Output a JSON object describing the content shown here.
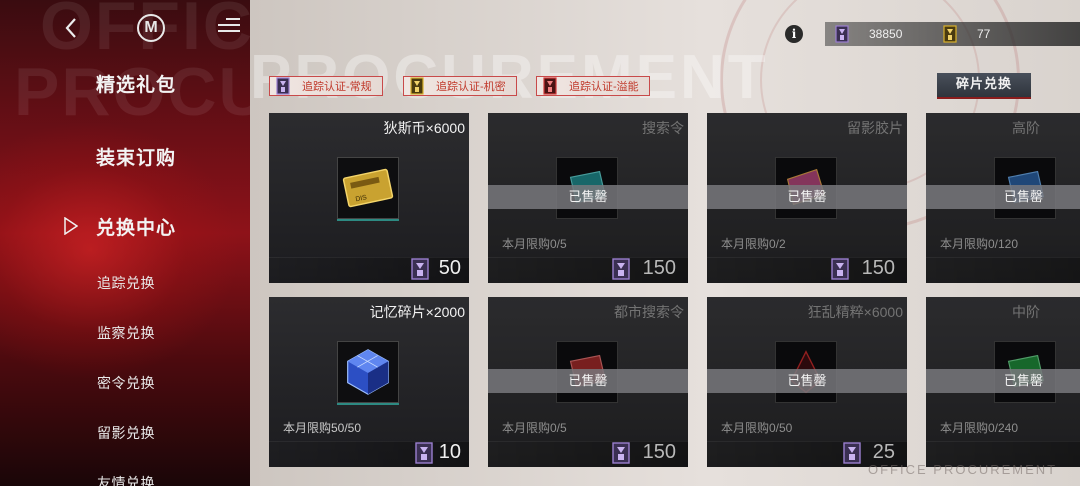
{
  "sidebar": {
    "nav_main": [
      {
        "label": "精选礼包"
      },
      {
        "label": "装束订购"
      },
      {
        "label": "兑换中心"
      }
    ],
    "nav_sub": [
      {
        "label": "追踪兑换"
      },
      {
        "label": "监察兑换"
      },
      {
        "label": "密令兑换"
      },
      {
        "label": "留影兑换"
      },
      {
        "label": "友情兑换"
      }
    ],
    "logo_letter": "M",
    "background_words": [
      "OFFICE",
      "PROCUREMENT"
    ]
  },
  "header": {
    "currencies": [
      {
        "icon": "tracking-cert-standard-icon",
        "amount": "38850",
        "color": "#9b7fd0"
      },
      {
        "icon": "tracking-cert-classified-icon",
        "amount": "77",
        "color": "#d9b12c"
      }
    ]
  },
  "filters": [
    {
      "label": "追踪认证-常规",
      "icon_color": "#9b7fd0"
    },
    {
      "label": "追踪认证-机密",
      "icon_color": "#d9b12c"
    },
    {
      "label": "追踪认证-溢能",
      "icon_color": "#d23a3a"
    }
  ],
  "fragment_exchange_label": "碎片兑换",
  "cards": [
    {
      "title": "狄斯币×6000",
      "limit": "",
      "price": "50",
      "sold_out": false,
      "thumb": "coin-pack"
    },
    {
      "title": "搜索令",
      "limit": "本月限购0/5",
      "price": "150",
      "sold_out": true,
      "thumb": "search-order"
    },
    {
      "title": "留影胶片",
      "limit": "本月限购0/2",
      "price": "150",
      "sold_out": true,
      "thumb": "film"
    },
    {
      "title": "高阶",
      "limit": "本月限购0/120",
      "price": "",
      "sold_out": true,
      "thumb": "advanced"
    },
    {
      "title": "记忆碎片×2000",
      "limit": "本月限购50/50",
      "price": "10",
      "sold_out": false,
      "thumb": "memory-cube"
    },
    {
      "title": "都市搜索令",
      "limit": "本月限购0/5",
      "price": "150",
      "sold_out": true,
      "thumb": "city-search"
    },
    {
      "title": "狂乱精粹×6000",
      "limit": "本月限购0/50",
      "price": "25",
      "sold_out": true,
      "thumb": "frenzy-essence"
    },
    {
      "title": "中阶",
      "limit": "本月限购0/240",
      "price": "",
      "sold_out": true,
      "thumb": "intermediate"
    }
  ],
  "sold_out_label": "已售罄",
  "footer_watermark": "OFFICE PROCUREMENT"
}
